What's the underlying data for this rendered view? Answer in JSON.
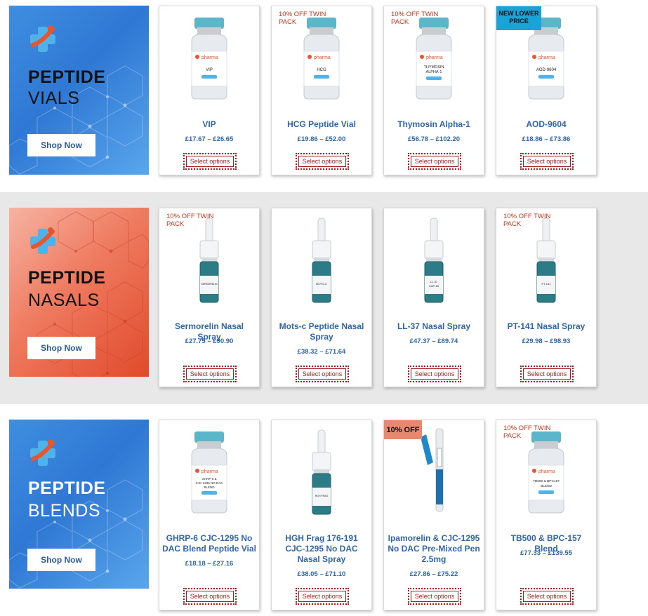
{
  "sections": [
    {
      "banner": {
        "title": "PEPTIDE",
        "subtitle": "VIALS",
        "button": "Shop Now"
      },
      "products": [
        {
          "name": "VIP",
          "price": "£17.67 – £26.65",
          "button": "Select options",
          "badge": "",
          "vial_label": "VIP"
        },
        {
          "name": "HCG Peptide Vial",
          "price": "£19.86 – £52.00",
          "button": "Select options",
          "badge": "10% OFF TWIN PACK",
          "vial_label": "HCG"
        },
        {
          "name": "Thymosin Alpha-1",
          "price": "£56.78 – £102.20",
          "button": "Select options",
          "badge": "10% OFF TWIN PACK",
          "vial_label": "THYMOSIN ALPHA-1"
        },
        {
          "name": "AOD-9604",
          "price": "£18.86 – £73.86",
          "button": "Select options",
          "badge": "NEW LOWER PRICE",
          "vial_label": "AOD-9604"
        }
      ]
    },
    {
      "banner": {
        "title": "PEPTIDE",
        "subtitle": "NASALS",
        "button": "Shop Now"
      },
      "products": [
        {
          "name": "Sermorelin Nasal Spray",
          "price": "£27.75 – £90.90",
          "button": "Select options",
          "badge": "10% OFF TWIN PACK",
          "vial_label": "SERMORELIN"
        },
        {
          "name": "Mots-c Peptide Nasal Spray",
          "price": "£38.32 – £71.64",
          "button": "Select options",
          "badge": "",
          "vial_label": "MOTS-C"
        },
        {
          "name": "LL-37 Nasal Spray",
          "price": "£47.37 – £89.74",
          "button": "Select options",
          "badge": "",
          "vial_label": "LL-37 CAP-18"
        },
        {
          "name": "PT-141 Nasal Spray",
          "price": "£29.98 – £98.93",
          "button": "Select options",
          "badge": "10% OFF TWIN PACK",
          "vial_label": "PT-141"
        }
      ]
    },
    {
      "banner": {
        "title": "PEPTIDE",
        "subtitle": "BLENDS",
        "button": "Shop Now"
      },
      "products": [
        {
          "name": "GHRP-6 CJC-1295 No DAC Blend Peptide Vial",
          "price": "£18.18 – £27.16",
          "button": "Select options",
          "badge": "",
          "vial_label": "GHRP-6 & CJC-1295 NO DAC BLEND"
        },
        {
          "name": "HGH Frag 176-191 CJC-1295 No DAC Nasal Spray",
          "price": "£38.05 – £71.10",
          "button": "Select options",
          "badge": "",
          "vial_label": "HGH FRAG"
        },
        {
          "name": "Ipamorelin & CJC-1295 No DAC Pre-Mixed Pen 2.5mg",
          "price": "£27.86 – £75.22",
          "button": "Select options",
          "badge": "10% OFF",
          "vial_label": ""
        },
        {
          "name": "TB500 & BPC-157 Blend",
          "price": "£77.33 – £139.55",
          "button": "Select options",
          "badge": "10% OFF TWIN PACK",
          "vial_label": "TB500 & BPC157 BLEND"
        }
      ]
    }
  ],
  "brand": "pharma",
  "colors": {
    "blue_banner": "#2f78d4",
    "red_banner": "#e14a2c",
    "product_link": "#2f66a8",
    "select_border": "#a11d1d",
    "badge_text": "#c0381b",
    "badge_blue": "#1ba3d8",
    "badge_salmon": "#e9876f"
  }
}
